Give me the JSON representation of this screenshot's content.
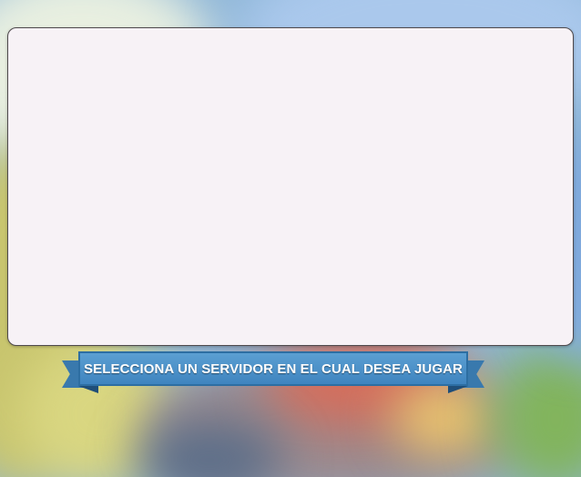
{
  "panel": {
    "title": "",
    "background": "#f7f2f6"
  },
  "banner": {
    "text": "SELECCIONA UN SERVIDOR EN EL CUAL DESEA JUGAR",
    "color": "#4a8cc4"
  }
}
